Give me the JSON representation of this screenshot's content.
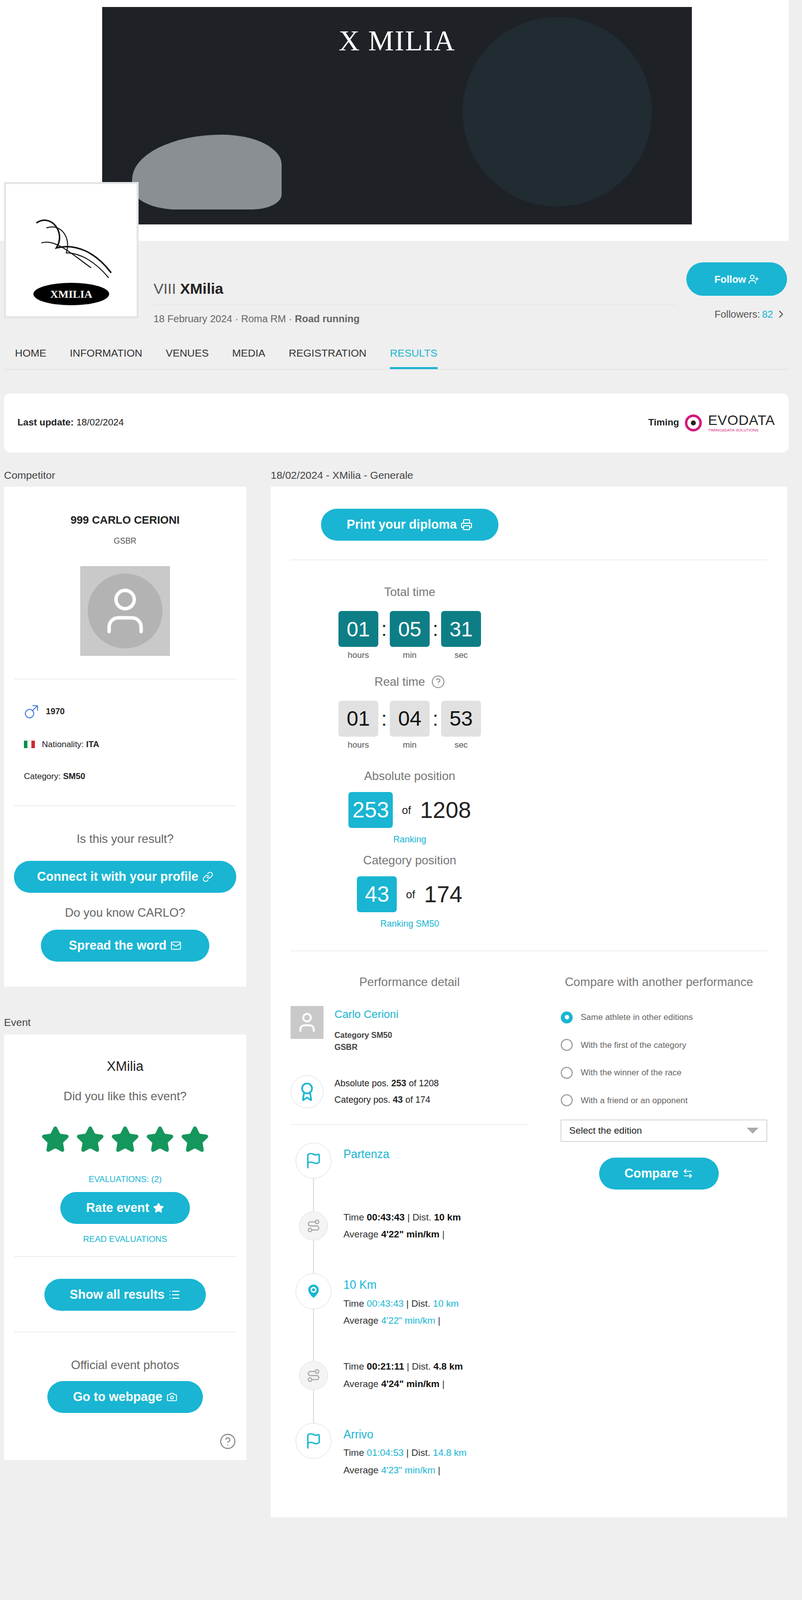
{
  "banner": {
    "title": "X MILIA"
  },
  "logo": {
    "text": "XMILIA"
  },
  "event_header": {
    "edition": "VIII",
    "name": "XMilia",
    "date": "18 February 2024",
    "place": "Roma RM",
    "type": "Road running",
    "separator": "·",
    "follow": "Follow",
    "followers_label": "Followers:",
    "followers": "82"
  },
  "nav": [
    {
      "label": "HOME",
      "selected": false
    },
    {
      "label": "INFORMATION",
      "selected": false
    },
    {
      "label": "VENUES",
      "selected": false
    },
    {
      "label": "MEDIA",
      "selected": false
    },
    {
      "label": "REGISTRATION",
      "selected": false
    },
    {
      "label": "RESULTS",
      "selected": true
    }
  ],
  "update": {
    "label": "Last update:",
    "date": "18/02/2024",
    "timing_label": "Timing",
    "timing_brand": "EVODATA",
    "timing_tagline": "TIMING&DATA SOLUTIONS"
  },
  "competitor": {
    "section": "Competitor",
    "name": "999 CARLO CERIONI",
    "club": "GSBR",
    "year": "1970",
    "nationality_label": "Nationality:",
    "nationality": "ITA",
    "category_label": "Category:",
    "category": "SM50",
    "claim_question": "Is this your result?",
    "claim_button": "Connect it with your profile",
    "share_question": "Do you know CARLO?",
    "share_button": "Spread the word"
  },
  "event": {
    "section": "Event",
    "name": "XMilia",
    "question": "Did you like this event?",
    "stars": 5,
    "evaluations": "EVALUATIONS: (2)",
    "rate_button": "Rate event",
    "read": "READ EVALUATIONS",
    "results_button": "Show all results",
    "photos_label": "Official event photos",
    "photos_button": "Go to webpage"
  },
  "result": {
    "title": "18/02/2024 - XMilia - Generale",
    "diploma_button": "Print your diploma",
    "times": [
      {
        "label": "Total time",
        "kind": "total",
        "help": false,
        "parts": [
          {
            "value": "01",
            "unit": "hours"
          },
          {
            "value": "05",
            "unit": "min"
          },
          {
            "value": "31",
            "unit": "sec"
          }
        ]
      },
      {
        "label": "Real time",
        "kind": "real",
        "help": true,
        "parts": [
          {
            "value": "01",
            "unit": "hours"
          },
          {
            "value": "04",
            "unit": "min"
          },
          {
            "value": "53",
            "unit": "sec"
          }
        ]
      }
    ],
    "separator": ":",
    "positions": [
      {
        "label": "Absolute position",
        "value": "253",
        "of": "of",
        "total": "1208",
        "link": "Ranking"
      },
      {
        "label": "Category position",
        "value": "43",
        "of": "of",
        "total": "174",
        "link": "Ranking SM50"
      }
    ]
  },
  "performance": {
    "title": "Performance detail",
    "athlete": "Carlo Cerioni",
    "category": "Category SM50",
    "club": "GSBR",
    "positions": [
      {
        "label": "Absolute pos.",
        "value": "253",
        "of": "of",
        "total": "1208"
      },
      {
        "label": "Category pos.",
        "value": "43",
        "of": "of",
        "total": "174"
      }
    ]
  },
  "compare": {
    "title": "Compare with another performance",
    "options": [
      {
        "label": "Same athlete in other editions",
        "selected": true
      },
      {
        "label": "With the first of the category",
        "selected": false
      },
      {
        "label": "With the winner of the race",
        "selected": false
      },
      {
        "label": "With a friend or an opponent",
        "selected": false
      }
    ],
    "select_placeholder": "Select the edition",
    "button": "Compare"
  },
  "timeline": {
    "time_label": "Time",
    "dist_label": "Dist.",
    "avg_label": "Average",
    "separator": "|",
    "items": [
      {
        "kind": "start",
        "title": "Partenza"
      },
      {
        "kind": "split",
        "time": "00:43:43",
        "dist": "10 km",
        "avg": "4'22\" min/km"
      },
      {
        "kind": "checkpoint",
        "title": "10 Km",
        "time": "00:43:43",
        "dist": "10 km",
        "avg": "4'22\" min/km"
      },
      {
        "kind": "split",
        "time": "00:21:11",
        "dist": "4.8 km",
        "avg": "4'24\" min/km"
      },
      {
        "kind": "finish",
        "title": "Arrivo",
        "time": "01:04:53",
        "dist": "14.8 km",
        "avg": "4'23\" min/km"
      }
    ]
  }
}
